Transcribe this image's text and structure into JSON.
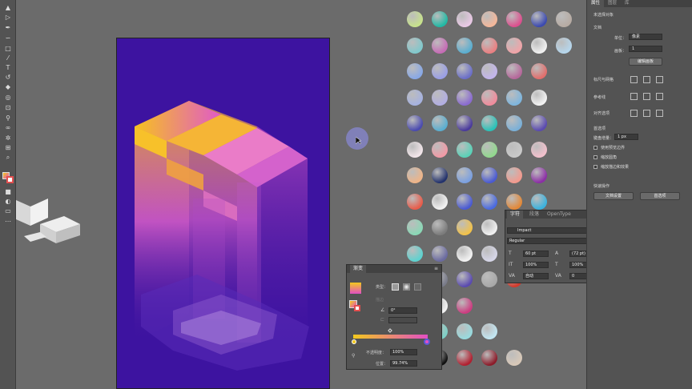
{
  "toolbar": {
    "tools": [
      "selection-tool",
      "direct-selection-tool",
      "pen-tool",
      "curvature-tool",
      "rectangle-tool",
      "paintbrush-tool",
      "pencil-tool",
      "type-tool",
      "rotate-tool",
      "scale-tool",
      "eraser-tool",
      "warp-tool",
      "free-transform-tool",
      "shape-builder-tool",
      "gradient-tool",
      "eyedropper-tool",
      "blend-tool",
      "symbol-sprayer-tool",
      "column-graph-tool",
      "artboard-tool",
      "hand-tool",
      "zoom-tool"
    ]
  },
  "swatches": {
    "rows": [
      [
        "#c7e28c",
        "#22b9a5",
        "#e9c8e5",
        "#f4b79a",
        "#dc4f8e",
        "#3c4ab0",
        "#b7aba3"
      ],
      [
        "#80c8cc",
        "#c66cb6",
        "#5aaed0",
        "#ea8082",
        "#f0a4a8",
        "#f0f0f0",
        "#b6d6ec"
      ],
      [
        "#88a8e6",
        "#9a9fe6",
        "#6b6fc8",
        "#c3b5ec",
        "#b6689b",
        "#e26e6c"
      ],
      [
        "#a6b2e0",
        "#b2aee2",
        "#8a6bd0",
        "#f08c9c",
        "#7eb6de",
        "#f2f2f2"
      ],
      [
        "#4a4ab0",
        "#5aaed0",
        "#4a3a9c",
        "#2ac2b8",
        "#7ab0d8",
        "#5a4ab0"
      ],
      [
        "#f2e6ea",
        "#f29aa6",
        "#5ad2b8",
        "#92d88e",
        "#c9c9c9",
        "#f2c0cc"
      ],
      [
        "#eeb488",
        "#23326c",
        "#7ba0e0",
        "#4a5ad2",
        "#f29a8e",
        "#8c2ea6"
      ],
      [
        "#e85c4a",
        "#f2f2f2",
        "#4a5ad2",
        "#4a6ae0",
        "#e28838",
        "#3bb2de"
      ],
      [
        "#8ad8b6",
        "#7c7c7c",
        "#f2c24a",
        "#f0f0f0",
        "#d8d8d8"
      ],
      [
        "#5ed2d0",
        "#6a6aa0",
        "#f2f2f2",
        "#d6d6e8",
        "#b8b8e6",
        "#6a6ab0"
      ],
      [
        "#ee2a6c",
        "#7a7c8a",
        "#5a4ab0",
        "#a8a8a8",
        "#d23a2c"
      ],
      [
        "#a4a6e6",
        "#f2f2f2",
        "#cc3c80"
      ],
      [
        "#e2b82a",
        "#7ed0c6",
        "#98dade",
        "#c2e6f2"
      ],
      [
        "#333",
        "#111",
        "#b02030",
        "#8c1c2a",
        "#d8c8b8"
      ]
    ]
  },
  "right_panel": {
    "tabs": [
      "属性",
      "图层",
      "库"
    ],
    "no_selection": "未选择对象",
    "document_section": "文档",
    "units_label": "单位：",
    "units_value": "像素",
    "artboard_label": "画板：",
    "artboard_value": "1",
    "edit_artboard_button": "编辑画板",
    "rulers_grid_label": "标尺与网格",
    "guides_label": "参考线",
    "align_to_label": "对齐选项",
    "preferences_label": "首选项",
    "keyboard_increment_label": "键盘增量：",
    "keyboard_increment_value": "1 px",
    "checkbox_preview_bounds": "使用预览边界",
    "checkbox_scale_corners": "缩放圆角",
    "checkbox_scale_strokes": "缩放描边和效果",
    "quick_actions_label": "快速操作",
    "doc_setup_button": "文档设置",
    "preferences_button": "首选项"
  },
  "gradient_panel": {
    "title": "渐变",
    "type_label": "类型：",
    "stroke_label": "描边",
    "angle_value": "0°",
    "opacity_label": "不透明度：",
    "opacity_value": "100%",
    "position_label": "位置：",
    "position_value": "99.74%",
    "bar_start": "#f2c81e",
    "bar_end": "#e24fc4"
  },
  "character_panel": {
    "tabs": [
      "字符",
      "段落",
      "OpenType"
    ],
    "font_family": "Impact",
    "font_style": "Regular",
    "font_size": "60 pt",
    "leading": "(72 pt)",
    "vscale": "100%",
    "hscale": "100%",
    "kerning": "自动",
    "tracking": "0"
  },
  "colors": {
    "artboard_bg": "#3d13a0",
    "accent_yellow": "#f2c81e",
    "accent_magenta": "#e24fc4"
  }
}
